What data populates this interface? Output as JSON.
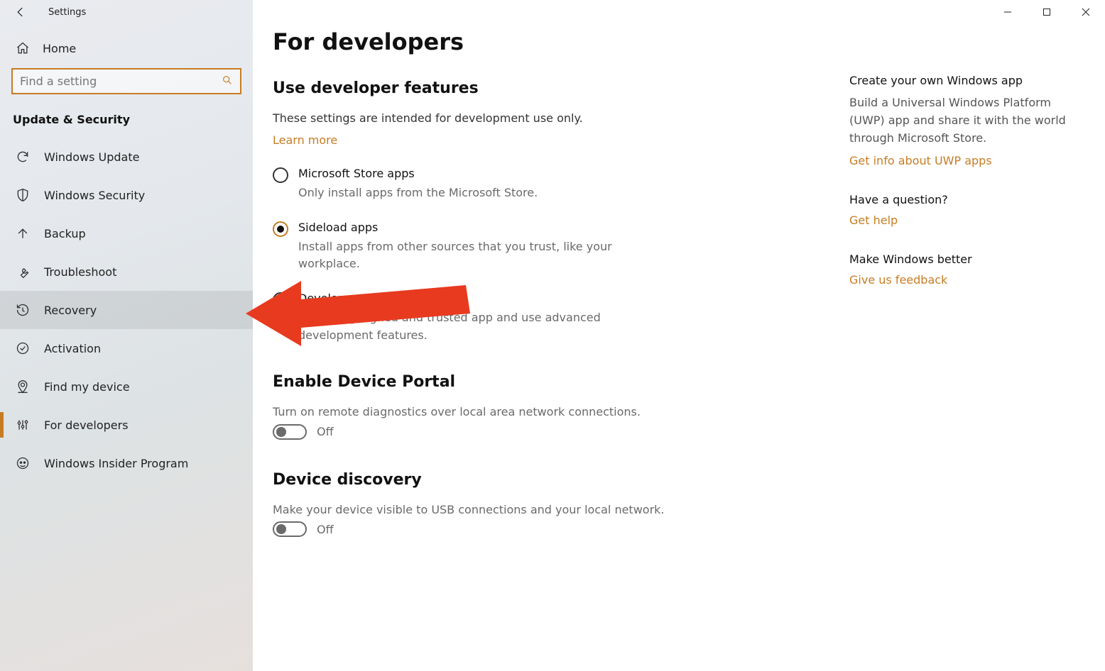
{
  "header": {
    "app_title": "Settings"
  },
  "sidebar": {
    "home_label": "Home",
    "search_placeholder": "Find a setting",
    "category_label": "Update & Security",
    "items": [
      {
        "label": "Windows Update",
        "icon": "sync-icon"
      },
      {
        "label": "Windows Security",
        "icon": "shield-icon"
      },
      {
        "label": "Backup",
        "icon": "arrow-up-icon"
      },
      {
        "label": "Troubleshoot",
        "icon": "wrench-icon"
      },
      {
        "label": "Recovery",
        "icon": "history-icon",
        "selected": true
      },
      {
        "label": "Activation",
        "icon": "check-circle-icon"
      },
      {
        "label": "Find my device",
        "icon": "location-icon"
      },
      {
        "label": "For developers",
        "icon": "sliders-icon",
        "accent": true
      },
      {
        "label": "Windows Insider Program",
        "icon": "insider-icon"
      }
    ]
  },
  "main": {
    "title": "For developers",
    "dev_features": {
      "heading": "Use developer features",
      "description": "These settings are intended for development use only.",
      "learn_more": "Learn more",
      "options": [
        {
          "title": "Microsoft Store apps",
          "desc": "Only install apps from the Microsoft Store.",
          "checked": false
        },
        {
          "title": "Sideload apps",
          "desc": "Install apps from other sources that you trust, like your workplace.",
          "checked": true
        },
        {
          "title": "Developer mode",
          "desc": "Install any signed and trusted app and use advanced development features.",
          "checked": false
        }
      ]
    },
    "device_portal": {
      "heading": "Enable Device Portal",
      "desc": "Turn on remote diagnostics over local area network connections.",
      "toggle_state": "Off"
    },
    "device_discovery": {
      "heading": "Device discovery",
      "desc": "Make your device visible to USB connections and your local network.",
      "toggle_state": "Off"
    }
  },
  "side_panel": {
    "create": {
      "head": "Create your own Windows app",
      "body": "Build a Universal Windows Platform (UWP) app and share it with the world through Microsoft Store.",
      "link": "Get info about UWP apps"
    },
    "question": {
      "head": "Have a question?",
      "link": "Get help"
    },
    "feedback": {
      "head": "Make Windows better",
      "link": "Give us feedback"
    }
  },
  "colors": {
    "accent": "#c77c23"
  }
}
